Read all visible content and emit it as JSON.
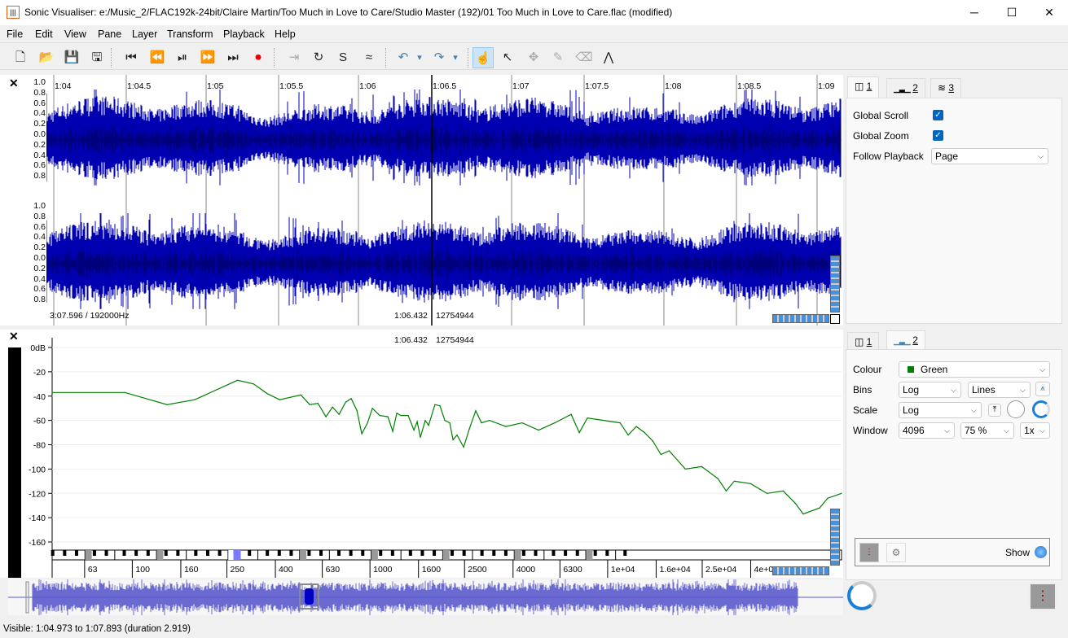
{
  "window": {
    "title": "Sonic Visualiser: e:/Music_2/FLAC192k-24bit/Claire Martin/Too Much in Love to Care/Studio Master (192)/01 Too Much in Love to Care.flac (modified)",
    "minimize": "─",
    "maximize": "☐",
    "close": "✕"
  },
  "menu": [
    "File",
    "Edit",
    "View",
    "Pane",
    "Layer",
    "Transform",
    "Playback",
    "Help"
  ],
  "toolbar": [
    {
      "name": "new-icon",
      "glyph": "🗋"
    },
    {
      "name": "open-icon",
      "glyph": "📂"
    },
    {
      "name": "save-icon",
      "glyph": "💾"
    },
    {
      "name": "save-as-icon",
      "glyph": "🖫"
    },
    {
      "name": "rewind-start-icon",
      "glyph": "⏮"
    },
    {
      "name": "rewind-icon",
      "glyph": "⏪"
    },
    {
      "name": "play-pause-icon",
      "glyph": "⏯"
    },
    {
      "name": "fast-forward-icon",
      "glyph": "⏩"
    },
    {
      "name": "ffwd-end-icon",
      "glyph": "⏭"
    },
    {
      "name": "record-icon",
      "glyph": "⏺"
    },
    {
      "name": "play-selection-icon",
      "glyph": "⇥"
    },
    {
      "name": "loop-icon",
      "glyph": "↻"
    },
    {
      "name": "solo-icon",
      "glyph": "S"
    },
    {
      "name": "speedup-icon",
      "glyph": "≈"
    },
    {
      "name": "undo-icon",
      "glyph": "↶"
    },
    {
      "name": "undo-menu-icon",
      "glyph": "▾"
    },
    {
      "name": "redo-icon",
      "glyph": "↷"
    },
    {
      "name": "redo-menu-icon",
      "glyph": "▾"
    },
    {
      "name": "navigate-tool-icon",
      "glyph": "☝"
    },
    {
      "name": "select-tool-icon",
      "glyph": "↖"
    },
    {
      "name": "move-tool-icon",
      "glyph": "✥"
    },
    {
      "name": "draw-tool-icon",
      "glyph": "✎"
    },
    {
      "name": "erase-tool-icon",
      "glyph": "⌫"
    },
    {
      "name": "measure-tool-icon",
      "glyph": "⋀"
    }
  ],
  "waveform_pane": {
    "close": "✕",
    "time_ticks": [
      "1:04",
      "1:04.5",
      "1:05",
      "1:05.5",
      "1:06",
      "1:06.5",
      "1:07",
      "1:07.5",
      "1:08",
      "1:08.5",
      "1:09"
    ],
    "y_labels": [
      "1.0",
      "0.8",
      "0.6",
      "0.4",
      "0.2",
      "0.0",
      "0.2",
      "0.4",
      "0.6",
      "0.8"
    ],
    "info_left": "3:07.596 / 192000Hz",
    "info_cursor": "1:06.432",
    "info_frame": "12754944",
    "wave_color": "#0000b0"
  },
  "spectrum_pane": {
    "close": "✕",
    "cursor_time": "1:06.432",
    "cursor_frame": "12754944",
    "line_color": "#008000"
  },
  "chart_data": {
    "type": "line",
    "x_scale": "log",
    "xlim": [
      46,
      96400
    ],
    "ylim": [
      -175,
      5
    ],
    "y_ticks": [
      {
        "v": 0,
        "label": "0dB"
      },
      {
        "v": -20,
        "label": "-20"
      },
      {
        "v": -40,
        "label": "-40"
      },
      {
        "v": -60,
        "label": "-60"
      },
      {
        "v": -80,
        "label": "-80"
      },
      {
        "v": -100,
        "label": "-100"
      },
      {
        "v": -120,
        "label": "-120"
      },
      {
        "v": -140,
        "label": "-140"
      },
      {
        "v": -160,
        "label": "-160"
      }
    ],
    "x_ticks": [
      {
        "v": 63,
        "label": "63"
      },
      {
        "v": 100,
        "label": "100"
      },
      {
        "v": 160,
        "label": "160"
      },
      {
        "v": 250,
        "label": "250"
      },
      {
        "v": 400,
        "label": "400"
      },
      {
        "v": 630,
        "label": "630"
      },
      {
        "v": 1000,
        "label": "1000"
      },
      {
        "v": 1600,
        "label": "1600"
      },
      {
        "v": 2500,
        "label": "2500"
      },
      {
        "v": 4000,
        "label": "4000"
      },
      {
        "v": 6300,
        "label": "6300"
      },
      {
        "v": 10000,
        "label": "1e+04"
      },
      {
        "v": 16000,
        "label": "1.6e+04"
      },
      {
        "v": 25000,
        "label": "2.5e+04"
      },
      {
        "v": 40000,
        "label": "4e+04"
      }
    ],
    "x": [
      46,
      93,
      140,
      183,
      277,
      324,
      370,
      417,
      512,
      558,
      604,
      653,
      696,
      741,
      790,
      834,
      882,
      924,
      977,
      1024,
      1099,
      1190,
      1247,
      1297,
      1349,
      1449,
      1531,
      1580,
      1630,
      1709,
      1764,
      1877,
      1970,
      2065,
      2167,
      2236,
      2324,
      2478,
      2618,
      2786,
      2944,
      3184,
      3730,
      4370,
      5120,
      5990,
      7020,
      7600,
      8220,
      9630,
      11280,
      12200,
      13200,
      14300,
      15480,
      16760,
      18140,
      21240,
      24880,
      29130,
      31520,
      34110,
      39940,
      46780,
      54780,
      61490,
      66530,
      77900,
      84300,
      96400
    ],
    "y": [
      -37,
      -37,
      -47,
      -43,
      -27,
      -30,
      -38,
      -43,
      -39,
      -47,
      -46,
      -57,
      -49,
      -55,
      -45,
      -42,
      -52,
      -71,
      -62,
      -50,
      -56,
      -57,
      -69,
      -54,
      -56,
      -56,
      -68,
      -61,
      -74,
      -60,
      -64,
      -47,
      -48,
      -60,
      -62,
      -76,
      -72,
      -82,
      -67,
      -52,
      -62,
      -60,
      -65,
      -62,
      -68,
      -62,
      -55,
      -70,
      -58,
      -60,
      -62,
      -72,
      -65,
      -70,
      -77,
      -88,
      -85,
      -100,
      -98,
      -108,
      -118,
      -110,
      -112,
      -120,
      -118,
      -128,
      -137,
      -132,
      -124,
      -120
    ]
  },
  "props_top": {
    "tabs": [
      "1",
      "2",
      "3"
    ],
    "global_scroll": "Global Scroll",
    "global_zoom": "Global Zoom",
    "follow_playback": "Follow Playback",
    "follow_value": "Page"
  },
  "props_bottom": {
    "tabs": [
      "1",
      "2"
    ],
    "colour_label": "Colour",
    "colour_value": "Green",
    "colour_swatch": "#008000",
    "bins_label": "Bins",
    "bins_value": "Log",
    "bins_style": "Lines",
    "scale_label": "Scale",
    "scale_value": "Log",
    "window_label": "Window",
    "window_size": "4096",
    "window_overlap": "75 %",
    "window_oversample": "1x",
    "show_label": "Show"
  },
  "status": "Visible: 1:04.973 to 1:07.893 (duration 2.919)"
}
